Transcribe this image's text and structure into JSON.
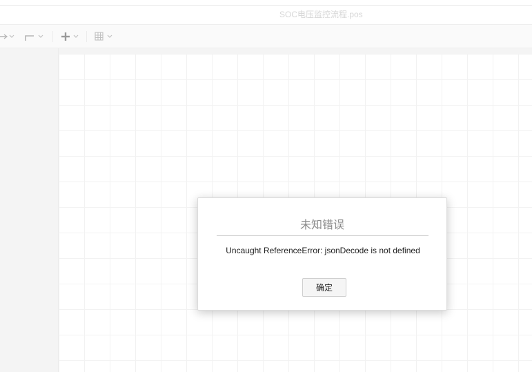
{
  "document": {
    "title": "SOC电压监控流程.pos"
  },
  "toolbar": {
    "items": [
      {
        "icon": "connector-arrow-icon"
      },
      {
        "icon": "waypoint-elbow-icon"
      },
      {
        "icon": "insert-plus-icon"
      },
      {
        "icon": "table-grid-icon"
      }
    ]
  },
  "dialog": {
    "title": "未知错误",
    "message": "Uncaught ReferenceError: jsonDecode is not defined",
    "ok_label": "确定"
  },
  "colors": {
    "canvas": "#ffffff",
    "grid_line": "#f2f2f2",
    "toolbar_icon": "#b4b4b4",
    "title_text": "#d6d6d6"
  }
}
